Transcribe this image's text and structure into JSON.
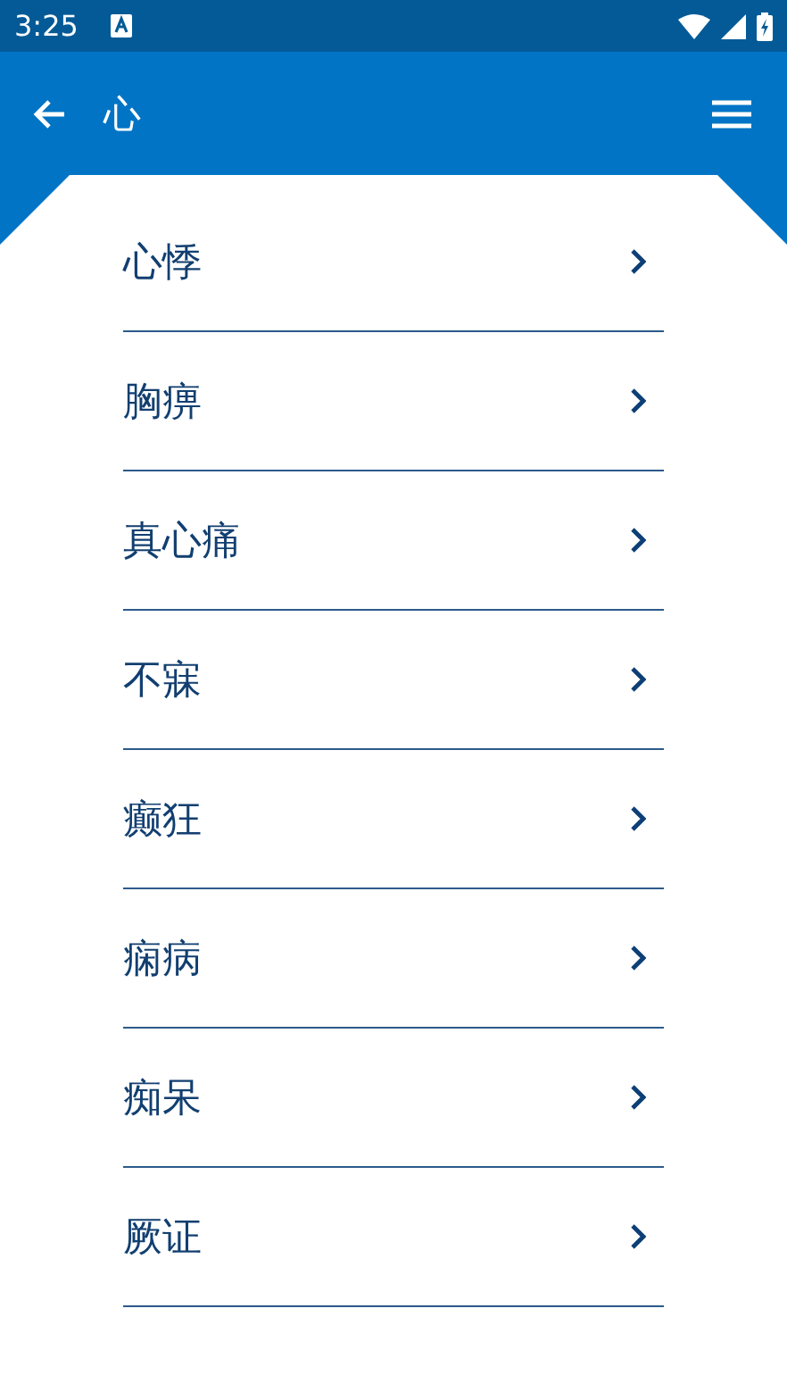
{
  "status_bar": {
    "time": "3:25"
  },
  "app_bar": {
    "title": "心"
  },
  "items": [
    {
      "label": "心悸"
    },
    {
      "label": "胸痹"
    },
    {
      "label": "真心痛"
    },
    {
      "label": "不寐"
    },
    {
      "label": "癫狂"
    },
    {
      "label": "痫病"
    },
    {
      "label": "痴呆"
    },
    {
      "label": "厥证"
    }
  ]
}
